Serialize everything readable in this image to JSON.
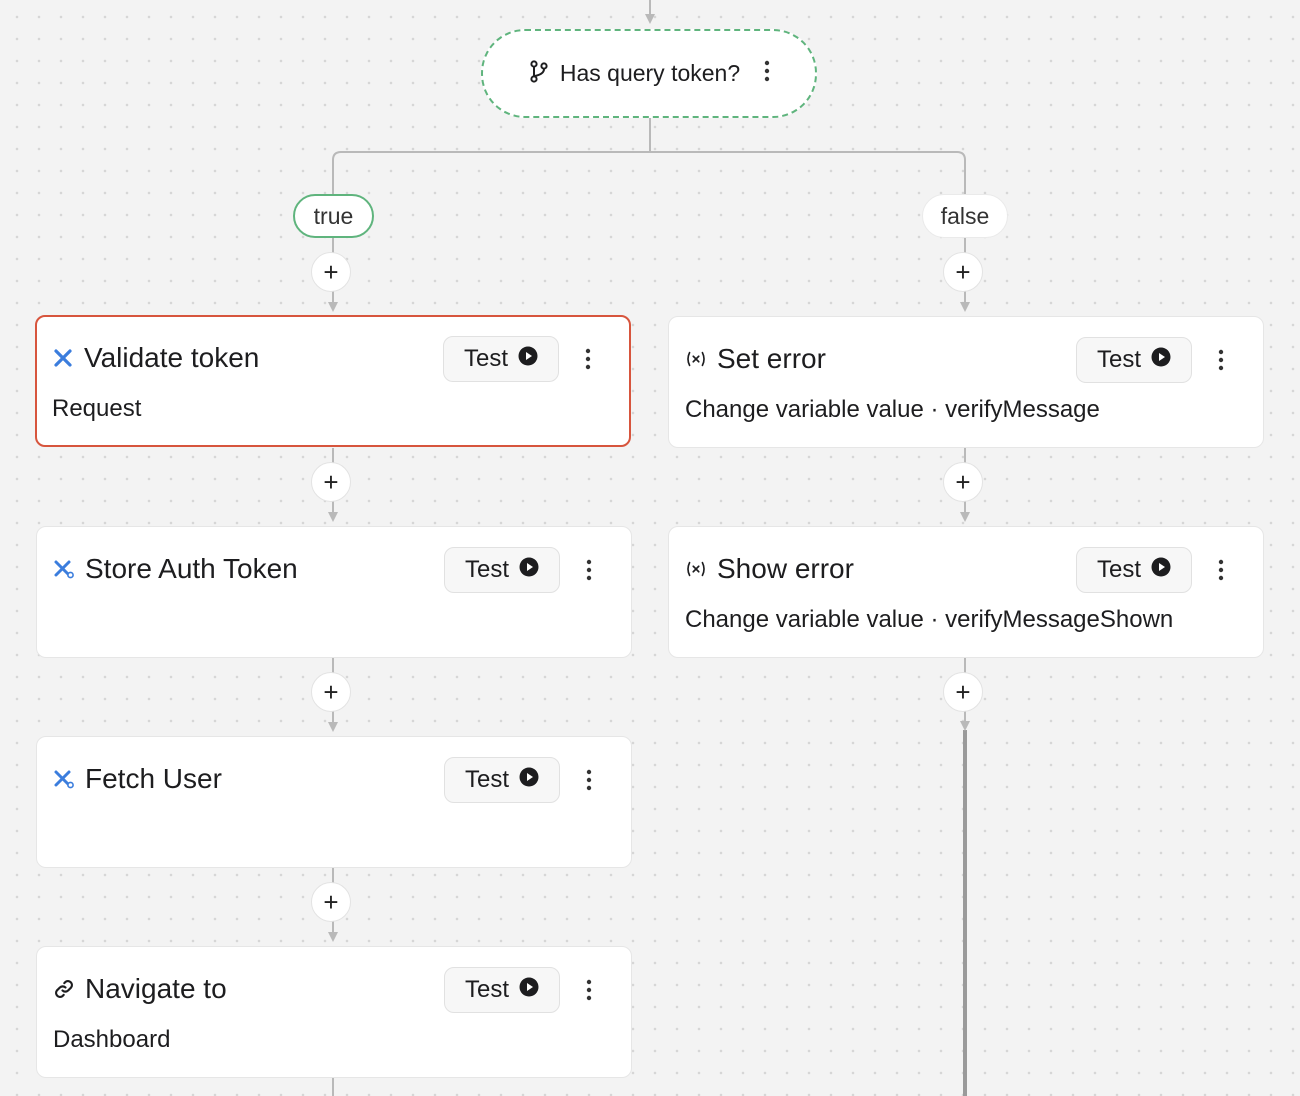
{
  "condition": {
    "label": "Has query token?",
    "icon": "branch-icon"
  },
  "branches": {
    "true_label": "true",
    "false_label": "false"
  },
  "add_step_label": "+",
  "colors": {
    "accent_green": "#5fb47d",
    "selected_red": "#d7553d",
    "request_blue": "#3b7ddd",
    "background": "#f3f3f3"
  },
  "cards": [
    {
      "id": "validate",
      "title": "Validate token",
      "subtitle": "Request",
      "icon": "request-x-icon",
      "test_label": "Test",
      "selected": true
    },
    {
      "id": "store",
      "title": "Store Auth Token",
      "subtitle": "",
      "icon": "request-x-icon",
      "test_label": "Test",
      "selected": false
    },
    {
      "id": "fetch",
      "title": "Fetch User",
      "subtitle": "",
      "icon": "request-x-icon",
      "test_label": "Test",
      "selected": false
    },
    {
      "id": "navigate",
      "title": "Navigate to",
      "subtitle": "Dashboard",
      "icon": "link-icon",
      "test_label": "Test",
      "selected": false
    },
    {
      "id": "seterror",
      "title": "Set error",
      "subtitle": "Change variable value · verifyMessage",
      "icon": "variable-icon",
      "test_label": "Test",
      "selected": false
    },
    {
      "id": "showerror",
      "title": "Show error",
      "subtitle": "Change variable value · verifyMessageShown",
      "icon": "variable-icon",
      "test_label": "Test",
      "selected": false
    }
  ]
}
